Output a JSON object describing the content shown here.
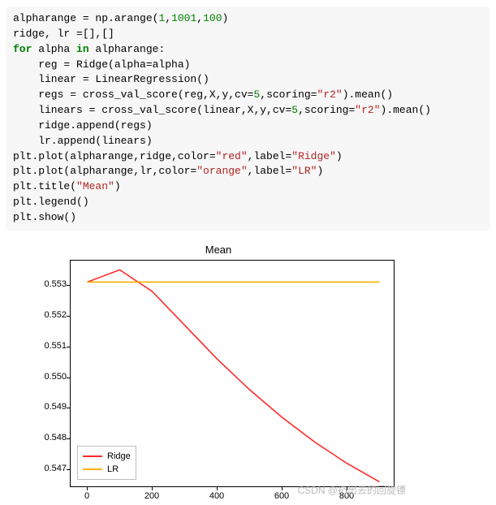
{
  "code": {
    "line1_a": "alpharange = np.arange(",
    "line1_n1": "1",
    "line1_c1": ",",
    "line1_n2": "1001",
    "line1_c2": ",",
    "line1_n3": "100",
    "line1_b": ")",
    "line2": "ridge, lr =[],[]",
    "line3_for": "for",
    "line3_mid": " alpha ",
    "line3_in": "in",
    "line3_b": " alpharange:",
    "line4": "    reg = Ridge(alpha=alpha)",
    "line5": "    linear = LinearRegression()",
    "line6_a": "    regs = cross_val_score(reg,X,y,cv=",
    "line6_n": "5",
    "line6_b": ",scoring=",
    "line6_s": "\"r2\"",
    "line6_c": ").mean()",
    "line7_a": "    linears = cross_val_score(linear,X,y,cv=",
    "line7_n": "5",
    "line7_b": ",scoring=",
    "line7_s": "\"r2\"",
    "line7_c": ").mean()",
    "line8": "    ridge.append(regs)",
    "line9": "    lr.append(linears)",
    "line10_a": "plt.plot(alpharange,ridge,color=",
    "line10_s1": "\"red\"",
    "line10_b": ",label=",
    "line10_s2": "\"Ridge\"",
    "line10_c": ")",
    "line11_a": "plt.plot(alpharange,lr,color=",
    "line11_s1": "\"orange\"",
    "line11_b": ",label=",
    "line11_s2": "\"LR\"",
    "line11_c": ")",
    "line12_a": "plt.title(",
    "line12_s": "\"Mean\"",
    "line12_b": ")",
    "line13": "plt.legend()",
    "line14": "plt.show()"
  },
  "colors": {
    "ridge": "#ff2a2a",
    "lr": "#ffb000"
  },
  "watermark": "CSDN @扔出去的回旋镖",
  "chart_data": {
    "type": "line",
    "title": "Mean",
    "xlabel": "",
    "ylabel": "",
    "xlim": [
      -50,
      950
    ],
    "ylim": [
      0.5464,
      0.5538
    ],
    "xticks": [
      0,
      200,
      400,
      600,
      800
    ],
    "yticks": [
      0.547,
      0.548,
      0.549,
      0.55,
      0.551,
      0.552,
      0.553
    ],
    "x": [
      1,
      101,
      201,
      301,
      401,
      501,
      601,
      701,
      801,
      901
    ],
    "series": [
      {
        "name": "Ridge",
        "color": "#ff2a2a",
        "values": [
          0.5531,
          0.5535,
          0.5528,
          0.5517,
          0.5506,
          0.5496,
          0.5487,
          0.5479,
          0.5472,
          0.5466
        ]
      },
      {
        "name": "LR",
        "color": "#ffb000",
        "values": [
          0.5531,
          0.5531,
          0.5531,
          0.5531,
          0.5531,
          0.5531,
          0.5531,
          0.5531,
          0.5531,
          0.5531
        ]
      }
    ],
    "legend_position": "lower left"
  }
}
